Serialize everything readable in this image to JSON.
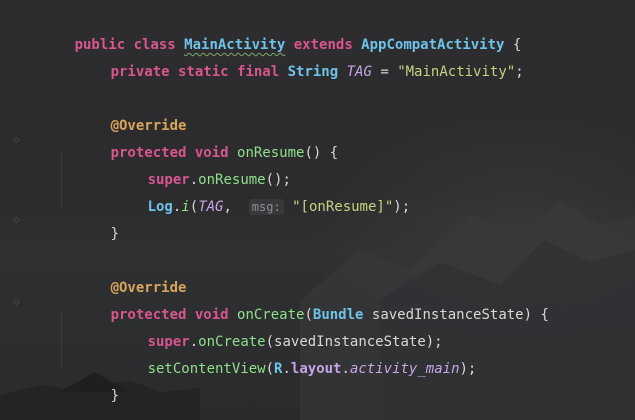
{
  "editor": {
    "language": "java",
    "theme_colors": {
      "keyword": "#d9558f",
      "class_name": "#6ec3e8",
      "method": "#8fe08a",
      "string": "#c9d17f",
      "field_italic": "#c5a5e6",
      "annotation": "#d8a55a",
      "plain": "#d8d8d8",
      "background": "#2b2b2c"
    },
    "lines": [
      {
        "tokens": [
          "public class ",
          "MainActivity",
          " extends ",
          "AppCompatActivity",
          " {"
        ]
      },
      {
        "tokens": [
          "private static final ",
          "String",
          " ",
          "TAG",
          " = ",
          "\"MainActivity\"",
          ";"
        ]
      },
      {
        "tokens": []
      },
      {
        "tokens": [
          "@Override"
        ]
      },
      {
        "tokens": [
          "protected void ",
          "onResume",
          "() {"
        ]
      },
      {
        "tokens": [
          "super",
          ".",
          "onResume",
          "();"
        ]
      },
      {
        "tokens": [
          "Log",
          ".",
          "i",
          "(",
          "TAG",
          ",  ",
          "msg:",
          " ",
          "\"[onResume]\"",
          ");"
        ]
      },
      {
        "tokens": [
          "}"
        ]
      },
      {
        "tokens": []
      },
      {
        "tokens": [
          "@Override"
        ]
      },
      {
        "tokens": [
          "protected void ",
          "onCreate",
          "(",
          "Bundle",
          " savedInstanceState) {"
        ]
      },
      {
        "tokens": [
          "super",
          ".",
          "onCreate",
          "(savedInstanceState);"
        ]
      },
      {
        "tokens": [
          "setContentView",
          "(",
          "R",
          ".",
          "layout",
          ".",
          "activity_main",
          ");"
        ]
      },
      {
        "tokens": [
          "}"
        ]
      }
    ]
  }
}
